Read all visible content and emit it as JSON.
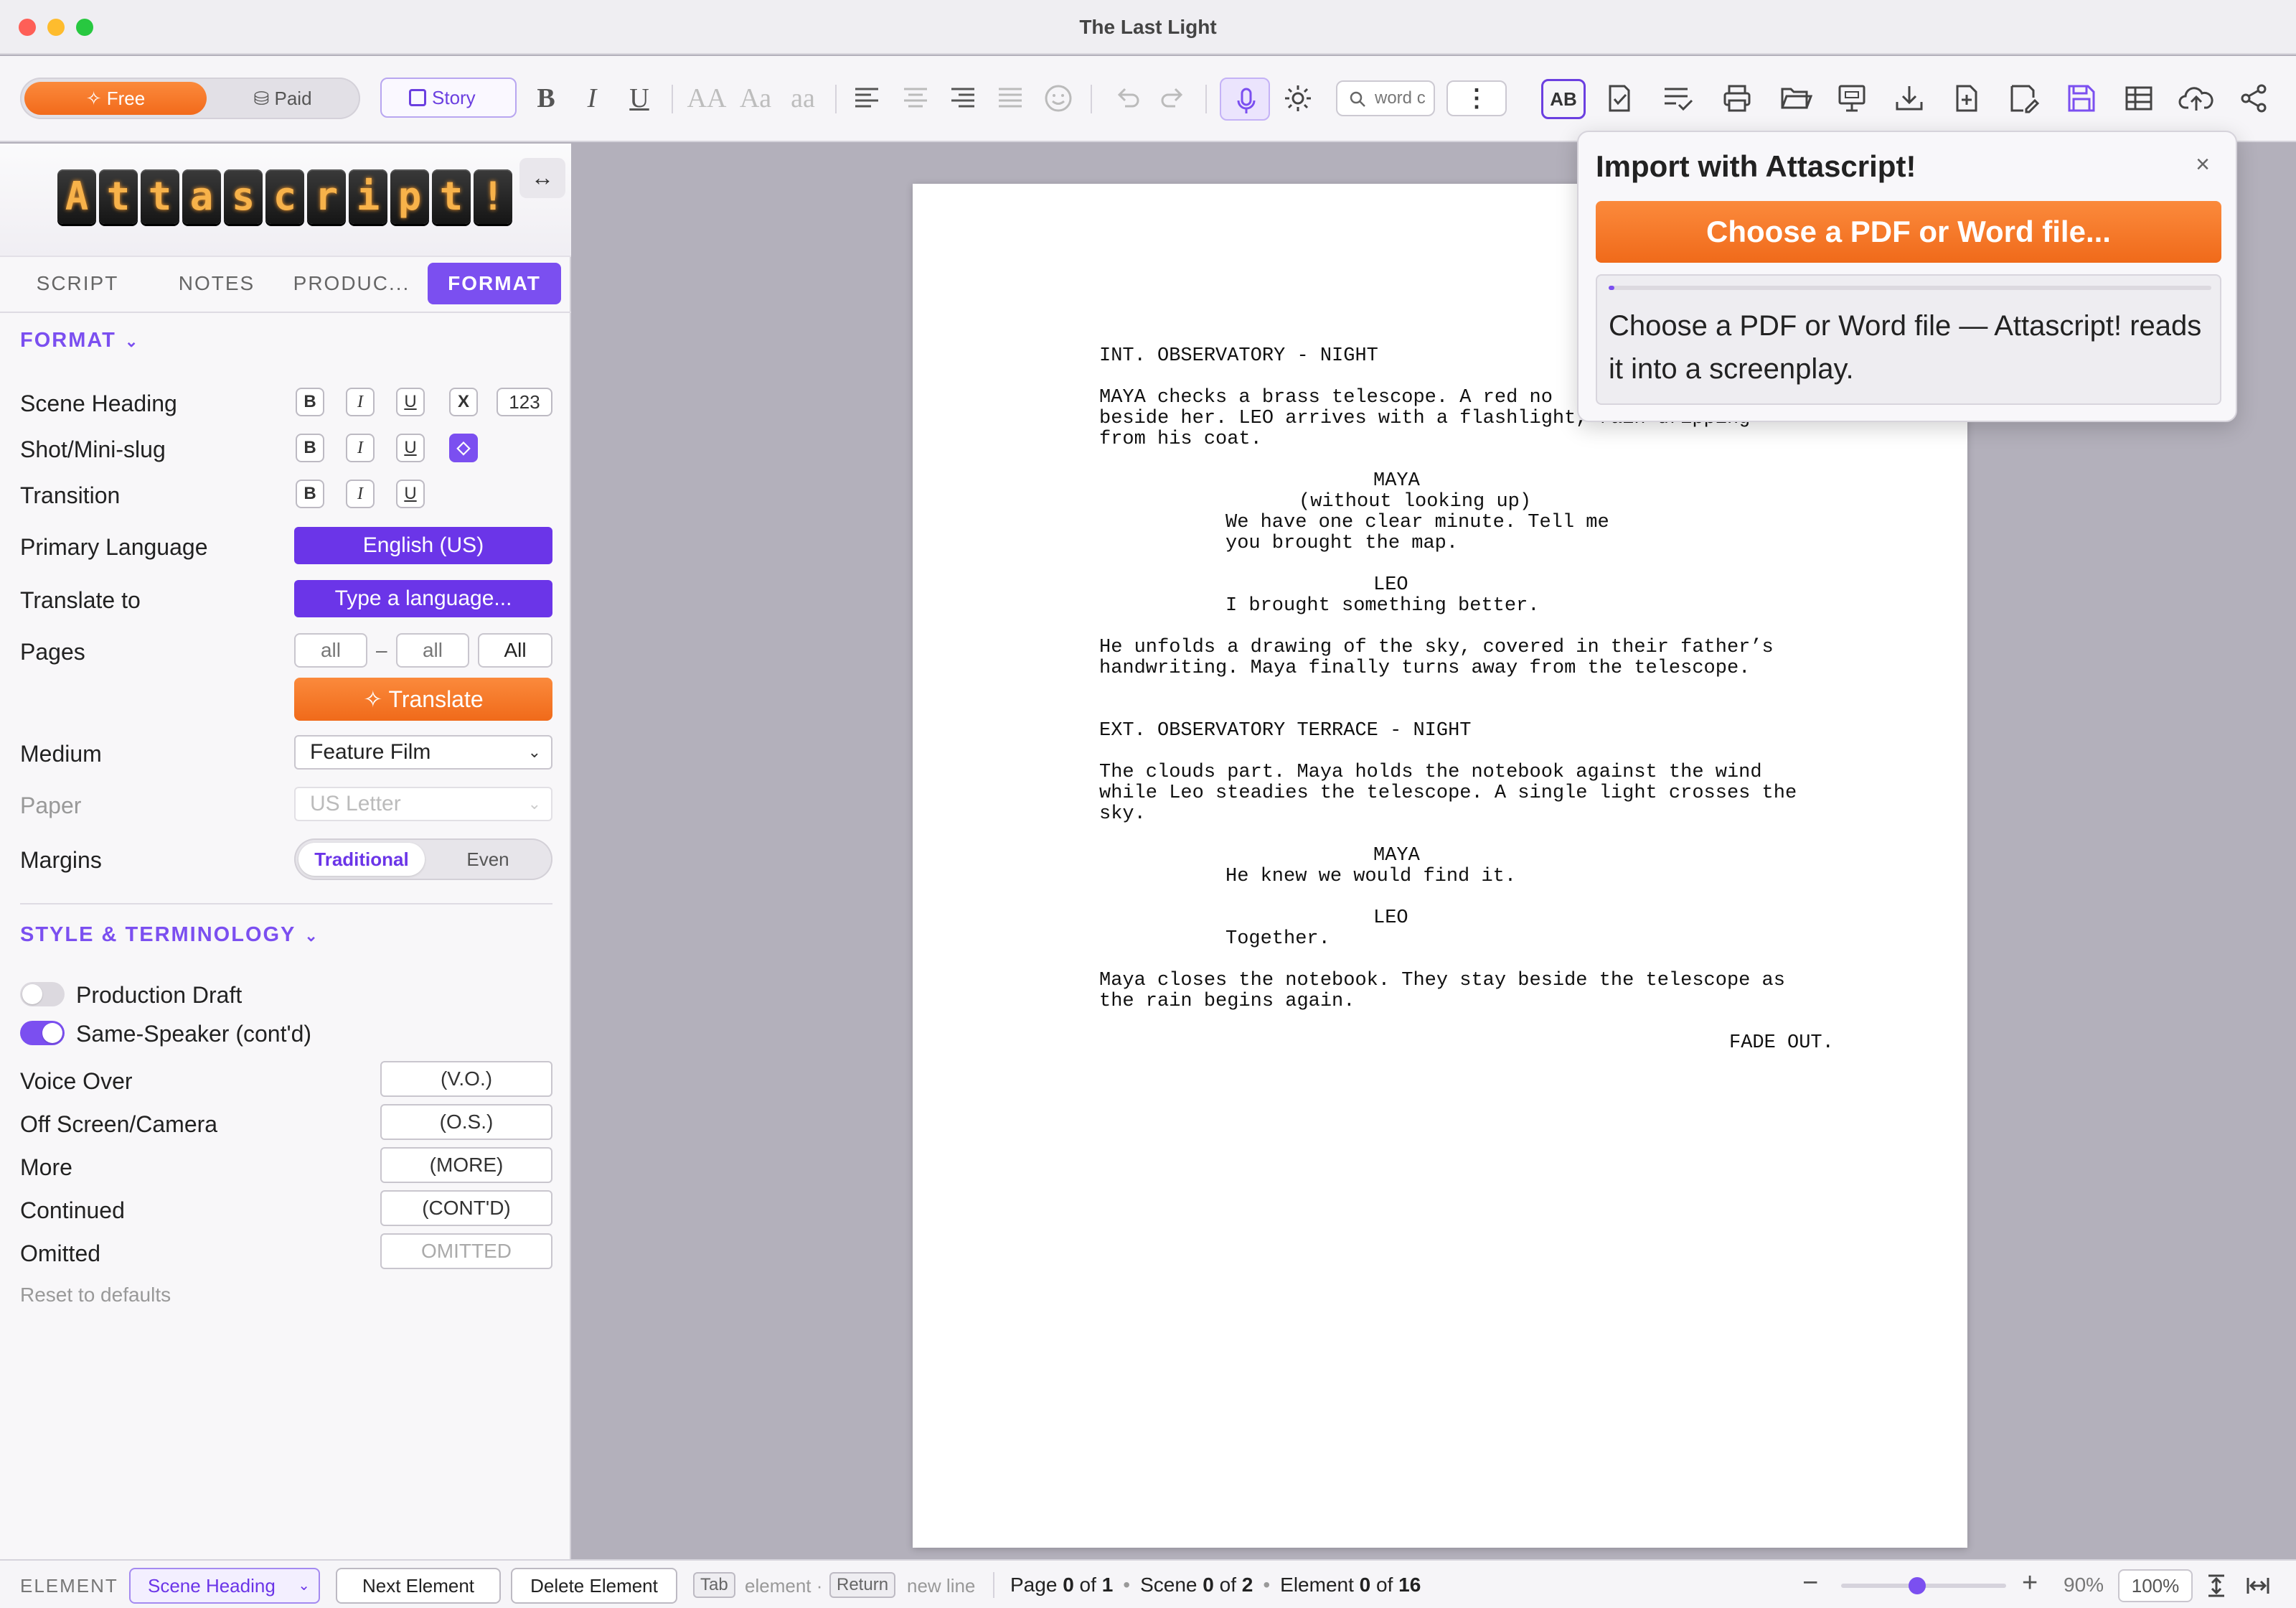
{
  "window": {
    "title": "The Last Light"
  },
  "toolbar": {
    "plan_free": "Free",
    "plan_paid": "Paid",
    "story": "Story",
    "bold": "B",
    "italic": "I",
    "underline": "U",
    "case_upper": "AA",
    "case_title": "Aa",
    "case_lower": "aa",
    "search_placeholder": "word c"
  },
  "sidebar": {
    "logo_letters": [
      "A",
      "t",
      "t",
      "a",
      "s",
      "c",
      "r",
      "i",
      "p",
      "t",
      "!"
    ],
    "tabs": [
      "SCRIPT",
      "NOTES",
      "PRODUC...",
      "FORMAT"
    ],
    "format_section": "FORMAT",
    "scene_heading": "Scene Heading",
    "shot_slug": "Shot/Mini-slug",
    "transition": "Transition",
    "fmt_b": "B",
    "fmt_i": "I",
    "fmt_u": "U",
    "fmt_x": "X",
    "fmt_num": "123",
    "primary_language_label": "Primary Language",
    "primary_language_value": "English (US)",
    "translate_to_label": "Translate to",
    "translate_to_placeholder": "Type a language...",
    "pages_label": "Pages",
    "pages_from": "all",
    "pages_dash": "–",
    "pages_to": "all",
    "pages_all": "All",
    "translate_button": "Translate",
    "medium_label": "Medium",
    "medium_value": "Feature Film",
    "paper_label": "Paper",
    "paper_value": "US Letter",
    "margins_label": "Margins",
    "margins_traditional": "Traditional",
    "margins_even": "Even",
    "style_section": "STYLE & TERMINOLOGY",
    "production_draft": "Production Draft",
    "same_speaker": "Same-Speaker (cont'd)",
    "voice_over_label": "Voice Over",
    "voice_over_value": "(V.O.)",
    "off_screen_label": "Off Screen/Camera",
    "off_screen_value": "(O.S.)",
    "more_label": "More",
    "more_value": "(MORE)",
    "continued_label": "Continued",
    "continued_value": "(CONT'D)",
    "omitted_label": "Omitted",
    "omitted_placeholder": "OMITTED",
    "reset": "Reset to defaults"
  },
  "script": {
    "scene1_heading": "INT. OBSERVATORY - NIGHT",
    "action1_l1": "MAYA checks a brass telescope. A red no",
    "action1_l2": "beside her. LEO arrives with a flashlight, rain dripping",
    "action1_l3": "from his coat.",
    "char_maya": "MAYA",
    "paren1": "(without looking up)",
    "dial1_l1": "We have one clear minute. Tell me",
    "dial1_l2": "you brought the map.",
    "char_leo": "LEO",
    "dial2": "I brought something better.",
    "action2_l1": "He unfolds a drawing of the sky, covered in their father’s",
    "action2_l2": "handwriting. Maya finally turns away from the telescope.",
    "scene2_heading": "EXT. OBSERVATORY TERRACE - NIGHT",
    "action3_l1": "The clouds part. Maya holds the notebook against the wind",
    "action3_l2": "while Leo steadies the telescope. A single light crosses the",
    "action3_l3": "sky.",
    "char_maya2": "MAYA",
    "dial3": "He knew we would find it.",
    "char_leo2": "LEO",
    "dial4": "Together.",
    "action4_l1": "Maya closes the notebook. They stay beside the telescope as",
    "action4_l2": "the rain begins again.",
    "transition": "FADE OUT."
  },
  "popover": {
    "title": "Import with Attascript!",
    "close": "×",
    "choose_button": "Choose a PDF or Word file...",
    "progress": 0.01,
    "message": "Choose a PDF or Word file — Attascript! reads it into a screenplay."
  },
  "statusbar": {
    "element_label": "ELEMENT",
    "element_value": "Scene Heading",
    "next_element": "Next Element",
    "delete_element": "Delete Element",
    "tab_key": "Tab",
    "tab_hint": "element ·",
    "return_key": "Return",
    "return_hint": "new line",
    "page_word": "Page",
    "page_current": "0",
    "page_of": "of",
    "page_total": "1",
    "scene_word": "Scene",
    "scene_current": "0",
    "scene_of": "of",
    "scene_total": "2",
    "element_word": "Element",
    "element_current": "0",
    "element_of": "of",
    "element_total": "16",
    "zoom_minus": "−",
    "zoom_plus": "+",
    "zoom_level": "90%",
    "zoom_reset": "100%"
  }
}
